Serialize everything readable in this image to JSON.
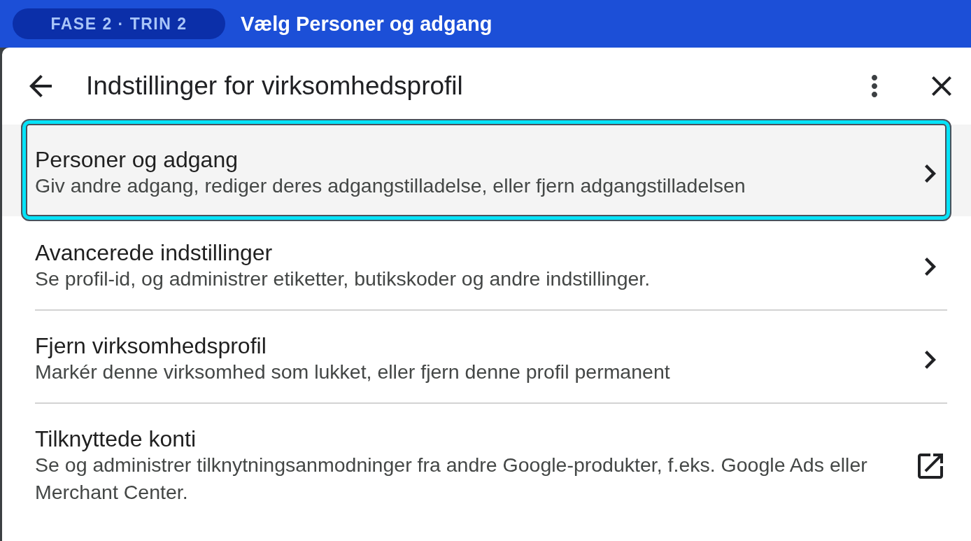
{
  "step_banner": {
    "badge": "FASE 2 · TRIN 2",
    "title": "Vælg Personer og adgang"
  },
  "dialog": {
    "title": "Indstillinger for virksomhedsprofil"
  },
  "items": [
    {
      "title": "Personer og adgang",
      "description": "Giv andre adgang, rediger deres adgangstilladelse, eller fjern adgangstilladelsen",
      "kind": "navigate",
      "selected": true
    },
    {
      "title": "Avancerede indstillinger",
      "description": "Se profil-id, og administrer etiketter, butikskoder og andre indstillinger.",
      "kind": "navigate",
      "selected": false
    },
    {
      "title": "Fjern virksomhedsprofil",
      "description": "Markér denne virksomhed som lukket, eller fjern denne profil permanent",
      "kind": "navigate",
      "selected": false
    },
    {
      "title": "Tilknyttede konti",
      "description": "Se og administrer tilknytningsanmodninger fra andre Google-produkter, f.eks. Google Ads eller Merchant Center.",
      "kind": "external",
      "selected": false
    }
  ]
}
